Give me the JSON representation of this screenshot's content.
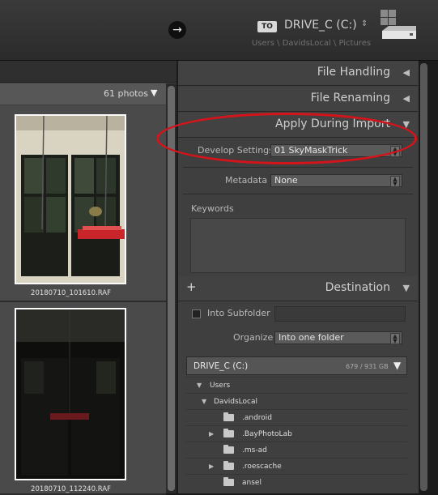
{
  "header": {
    "to_badge": "TO",
    "drive_name": "DRIVE_C (C:)",
    "drive_updown": "⇕",
    "path": "Users \\ DavidsLocal \\ Pictures",
    "forward_arrow": "→"
  },
  "grid": {
    "photo_count": "61 photos",
    "sort_arrow": "▼",
    "photos": [
      {
        "filename": "20180710_101610.RAF"
      },
      {
        "filename": "20180710_112240.RAF"
      }
    ]
  },
  "panels": {
    "file_handling": {
      "title": "File Handling",
      "arrow": "◀"
    },
    "file_renaming": {
      "title": "File Renaming",
      "arrow": "◀"
    },
    "apply_during_import": {
      "title": "Apply During Import",
      "arrow": "▼",
      "develop_settings_label": "Develop Settings",
      "develop_settings_value": "01 SkyMaskTrick",
      "metadata_label": "Metadata",
      "metadata_value": "None",
      "keywords_label": "Keywords",
      "keywords_value": ""
    },
    "destination": {
      "plus": "+",
      "title": "Destination",
      "arrow": "▼",
      "into_subfolder_label": "Into Subfolder",
      "subfolder_value": "",
      "organize_label": "Organize",
      "organize_value": "Into one folder",
      "drive_label": "DRIVE_C (C:)",
      "drive_space": "679 / 931 GB",
      "drive_arrow": "▼",
      "tree": [
        {
          "label": "Users",
          "expander": "▼"
        },
        {
          "label": "DavidsLocal",
          "expander": "▼"
        },
        {
          "label": ".android",
          "expander": ""
        },
        {
          "label": ".BayPhotoLab",
          "expander": "▶"
        },
        {
          "label": ".ms-ad",
          "expander": ""
        },
        {
          "label": ".roescache",
          "expander": "▶"
        },
        {
          "label": "ansel",
          "expander": ""
        }
      ]
    }
  },
  "colors": {
    "annotation": "#d4141b",
    "panel_bg": "#3f3f3f"
  }
}
